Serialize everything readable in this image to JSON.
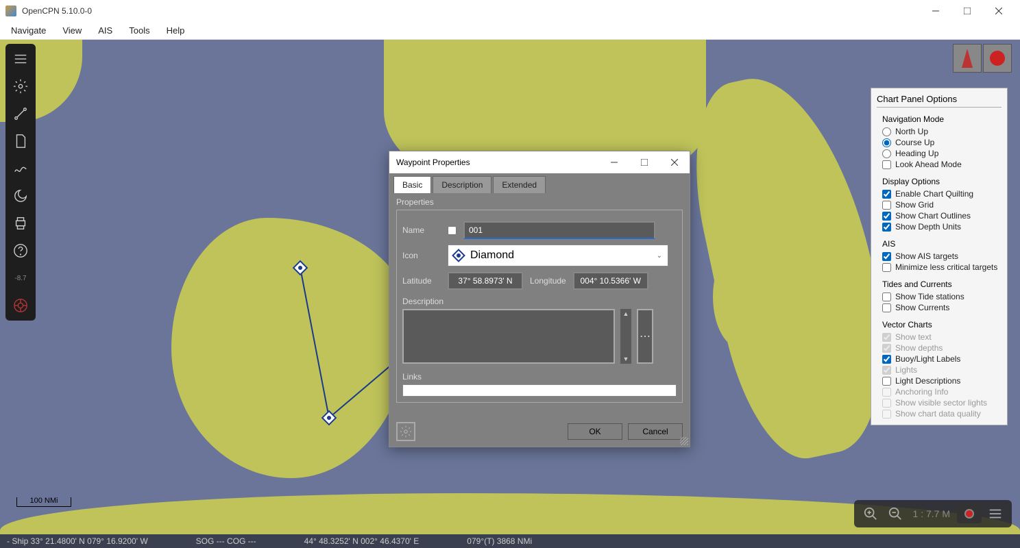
{
  "window": {
    "title": "OpenCPN 5.10.0-0"
  },
  "menus": [
    "Navigate",
    "View",
    "AIS",
    "Tools",
    "Help"
  ],
  "scalebar": "100 NMi",
  "zoom_scale": "1 : 7.7 M",
  "statusbar": {
    "ship": "- Ship 33° 21.4800' N   079° 16.9200' W",
    "sog": "SOG --- COG ---",
    "cursor": "44° 48.3252' N   002° 46.4370' E",
    "heading": "079°(T)  3868 NMi"
  },
  "chart_panel": {
    "title": "Chart Panel Options",
    "nav_mode_label": "Navigation Mode",
    "nav_mode": {
      "north": "North Up",
      "course": "Course Up",
      "heading": "Heading Up",
      "look": "Look Ahead Mode"
    },
    "display_label": "Display Options",
    "display": {
      "quilting": "Enable Chart Quilting",
      "grid": "Show Grid",
      "outlines": "Show Chart Outlines",
      "depth": "Show Depth Units"
    },
    "ais_label": "AIS",
    "ais": {
      "show": "Show AIS targets",
      "minimize": "Minimize less critical targets"
    },
    "tides_label": "Tides and Currents",
    "tides": {
      "stations": "Show Tide stations",
      "currents": "Show Currents"
    },
    "vector_label": "Vector Charts",
    "vector": {
      "text": "Show text",
      "depths": "Show depths",
      "buoy": "Buoy/Light Labels",
      "lights": "Lights",
      "lightdesc": "Light Descriptions",
      "anchoring": "Anchoring Info",
      "sector": "Show visible sector lights",
      "quality": "Show chart data quality"
    }
  },
  "dialog": {
    "title": "Waypoint Properties",
    "tabs": {
      "basic": "Basic",
      "description": "Description",
      "extended": "Extended"
    },
    "section_properties": "Properties",
    "name_label": "Name",
    "name_value": "001",
    "icon_label": "Icon",
    "icon_value": "Diamond",
    "lat_label": "Latitude",
    "lat_value": "37° 58.8973' N",
    "lon_label": "Longitude",
    "lon_value": "004° 10.5366' W",
    "desc_label": "Description",
    "links_label": "Links",
    "ok": "OK",
    "cancel": "Cancel"
  }
}
